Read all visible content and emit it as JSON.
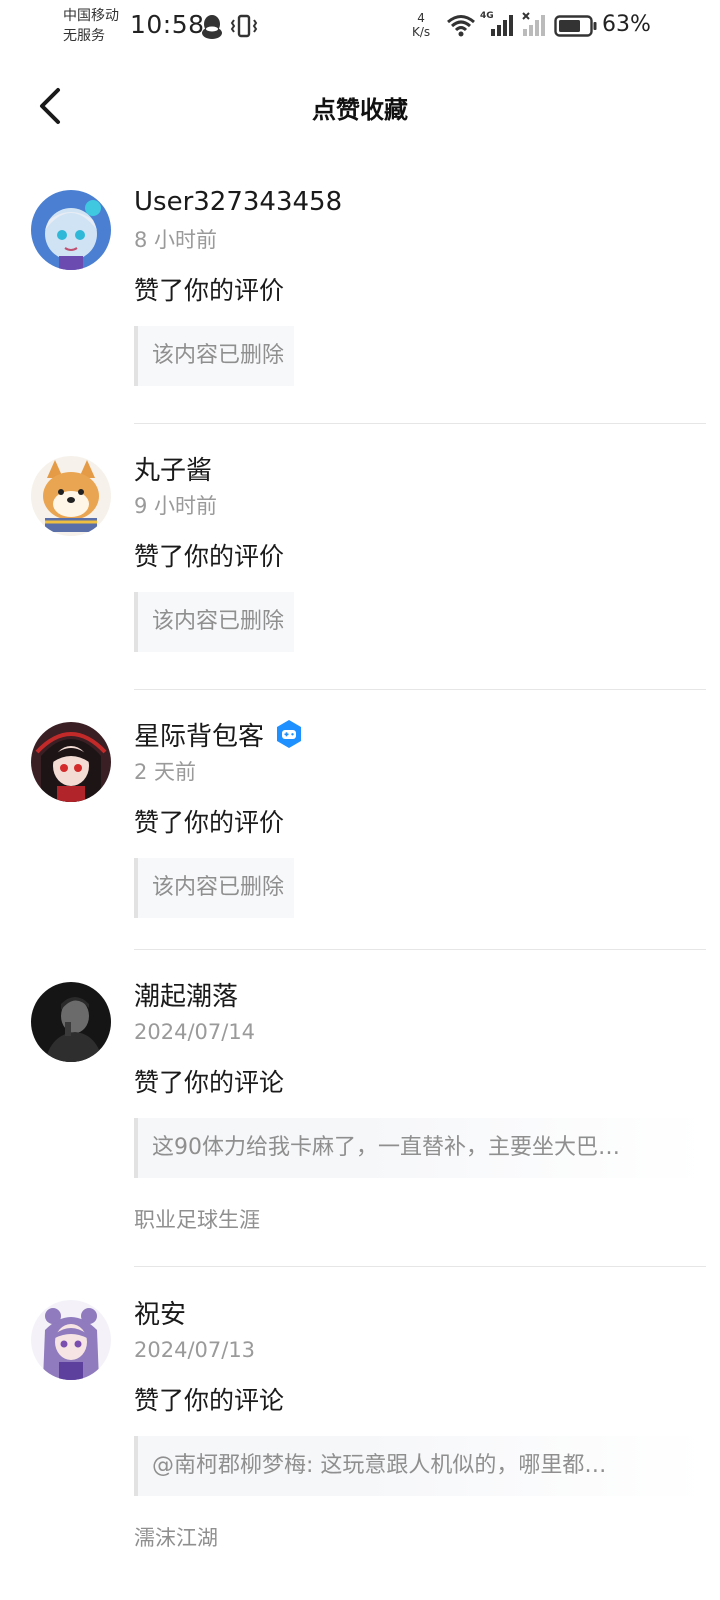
{
  "status_bar": {
    "carrier_line1": "中国移动",
    "carrier_line2": "无服务",
    "time": "10:58",
    "speed_value": "4",
    "speed_unit": "K/s",
    "network": "4G",
    "battery": "63%"
  },
  "header": {
    "title": "点赞收藏"
  },
  "items": [
    {
      "user": "User327343458",
      "time": "8 小时前",
      "action": "赞了你的评价",
      "quote": "该内容已删除",
      "game": ""
    },
    {
      "user": "丸子酱",
      "time": "9 小时前",
      "action": "赞了你的评价",
      "quote": "该内容已删除",
      "game": ""
    },
    {
      "user": "星际背包客",
      "time": "2 天前",
      "action": "赞了你的评价",
      "quote": "该内容已删除",
      "game": "",
      "badge": "game-badge-icon"
    },
    {
      "user": "潮起潮落",
      "time": "2024/07/14",
      "action": "赞了你的评论",
      "quote": "这90体力给我卡麻了，一直替补，主要坐大巴…",
      "game": "职业足球生涯"
    },
    {
      "user": "祝安",
      "time": "2024/07/13",
      "action": "赞了你的评论",
      "quote": "@南柯郡柳梦梅: 这玩意跟人机似的，哪里都…",
      "game": "濡沫江湖"
    }
  ],
  "colors": {
    "muted_text": "#9a9a9a",
    "badge_blue": "#1e90ff",
    "divider": "#e6e6e6"
  }
}
